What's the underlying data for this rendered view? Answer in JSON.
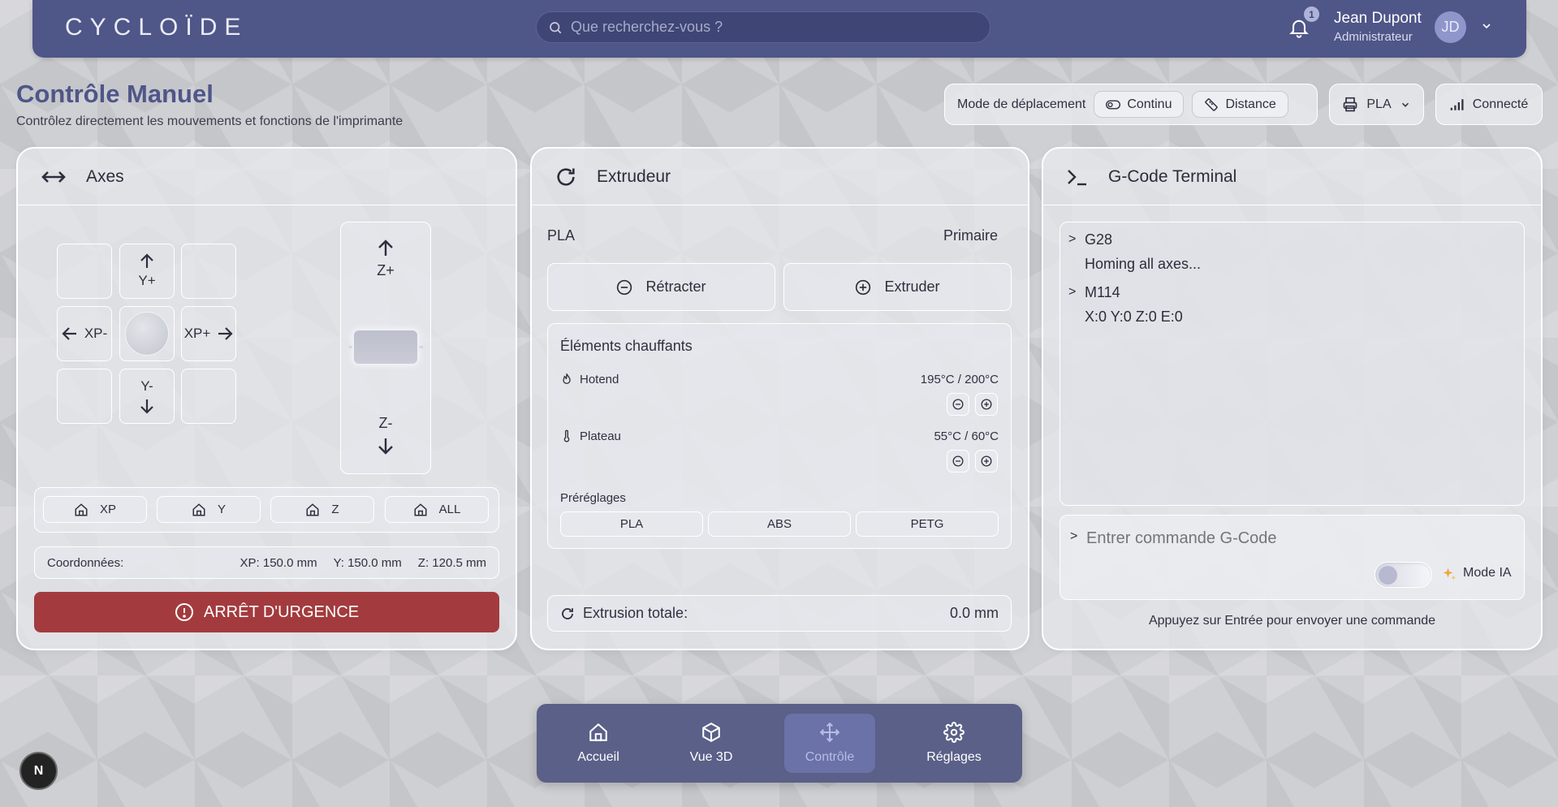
{
  "header": {
    "logo": "CYCLOÏDE",
    "search_placeholder": "Que recherchez-vous ?",
    "notification_count": "1",
    "user_name": "Jean Dupont",
    "user_role": "Administrateur",
    "avatar_initials": "JD"
  },
  "page": {
    "title": "Contrôle Manuel",
    "subtitle": "Contrôlez directement les mouvements et fonctions de l'imprimante"
  },
  "toolbar": {
    "mode_label": "Mode de déplacement",
    "continuous_label": "Continu",
    "distance_label": "Distance",
    "material_label": "PLA",
    "connection_label": "Connecté"
  },
  "axes": {
    "title": "Axes",
    "y_plus": "Y+",
    "y_minus": "Y-",
    "x_minus": "XP-",
    "x_plus": "XP+",
    "z_plus": "Z+",
    "z_minus": "Z-",
    "home_buttons": [
      "XP",
      "Y",
      "Z",
      "ALL"
    ],
    "coords_label": "Coordonnées:",
    "coord_x": "XP: 150.0 mm",
    "coord_y": "Y: 150.0 mm",
    "coord_z": "Z: 120.5 mm",
    "emergency_label": "ARRÊT D'URGENCE"
  },
  "extruder": {
    "title": "Extrudeur",
    "material": "PLA",
    "slot": "Primaire",
    "retract_label": "Rétracter",
    "extrude_label": "Extruder",
    "heaters_title": "Éléments chauffants",
    "hotend_label": "Hotend",
    "hotend_value": "195°C / 200°C",
    "bed_label": "Plateau",
    "bed_value": "55°C / 60°C",
    "presets_title": "Préréglages",
    "presets": [
      "PLA",
      "ABS",
      "PETG"
    ],
    "total_label": "Extrusion totale:",
    "total_value": "0.0 mm"
  },
  "terminal": {
    "title": "G-Code Terminal",
    "lines": [
      {
        "prompt": ">",
        "text": "G28"
      },
      {
        "prompt": "",
        "text": "Homing all axes..."
      },
      {
        "prompt": ">",
        "text": "M114"
      },
      {
        "prompt": "",
        "text": "X:0 Y:0 Z:0 E:0"
      }
    ],
    "input_prompt": ">",
    "input_placeholder": "Entrer commande G-Code",
    "ai_toggle_label": "Mode IA",
    "ai_toggle_on": false,
    "hint": "Appuyez sur Entrée pour envoyer une commande"
  },
  "nav": {
    "items": [
      {
        "label": "Accueil",
        "icon": "home-icon"
      },
      {
        "label": "Vue 3D",
        "icon": "cube-icon"
      },
      {
        "label": "Contrôle",
        "icon": "move-icon",
        "active": true
      },
      {
        "label": "Réglages",
        "icon": "gear-icon"
      }
    ]
  },
  "dev_badge": "N",
  "colors": {
    "brand": "#4f5688",
    "emergency": "#a33b3e",
    "nav_active": "#6a72a7"
  }
}
